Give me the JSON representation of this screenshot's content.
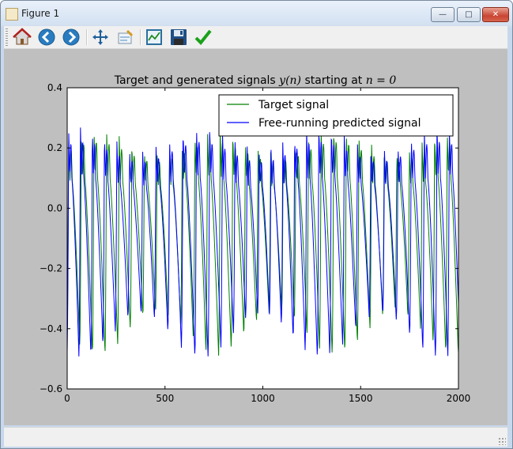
{
  "window": {
    "title": "Figure 1"
  },
  "toolbar": {
    "buttons": [
      {
        "name": "home",
        "icon": "home-icon"
      },
      {
        "name": "back",
        "icon": "arrow-left-icon"
      },
      {
        "name": "forward",
        "icon": "arrow-right-icon"
      },
      {
        "name": "pan",
        "icon": "move-arrows-icon"
      },
      {
        "name": "zoom",
        "icon": "zoom-rect-icon"
      },
      {
        "name": "subplots",
        "icon": "subplots-config-icon"
      },
      {
        "name": "save",
        "icon": "floppy-disk-icon"
      },
      {
        "name": "edit",
        "icon": "checkmark-icon"
      }
    ]
  },
  "chart_data": {
    "type": "line",
    "title_text": "Target and generated signals ",
    "title_math1": "y(n)",
    "title_text2": " starting at ",
    "title_math2": "n = 0",
    "xlim": [
      0,
      2000
    ],
    "ylim": [
      -0.6,
      0.4
    ],
    "x_ticks": [
      "0",
      "500",
      "1000",
      "1500",
      "2000"
    ],
    "y_ticks": [
      "0.4",
      "0.2",
      "0.0",
      "−0.2",
      "−0.4",
      "−0.6"
    ],
    "legend_position": "upper right",
    "series": [
      {
        "name": "Target signal",
        "color": "#008000",
        "period": 64.5,
        "phase": 0.0,
        "drift": 0.0,
        "peak": 0.27,
        "trough": -0.49
      },
      {
        "name": "Free-running predicted signal",
        "color": "#0000ff",
        "period": 64.5,
        "phase": 0.0,
        "drift": 1.2,
        "peak": 0.28,
        "trough": -0.5
      }
    ]
  }
}
